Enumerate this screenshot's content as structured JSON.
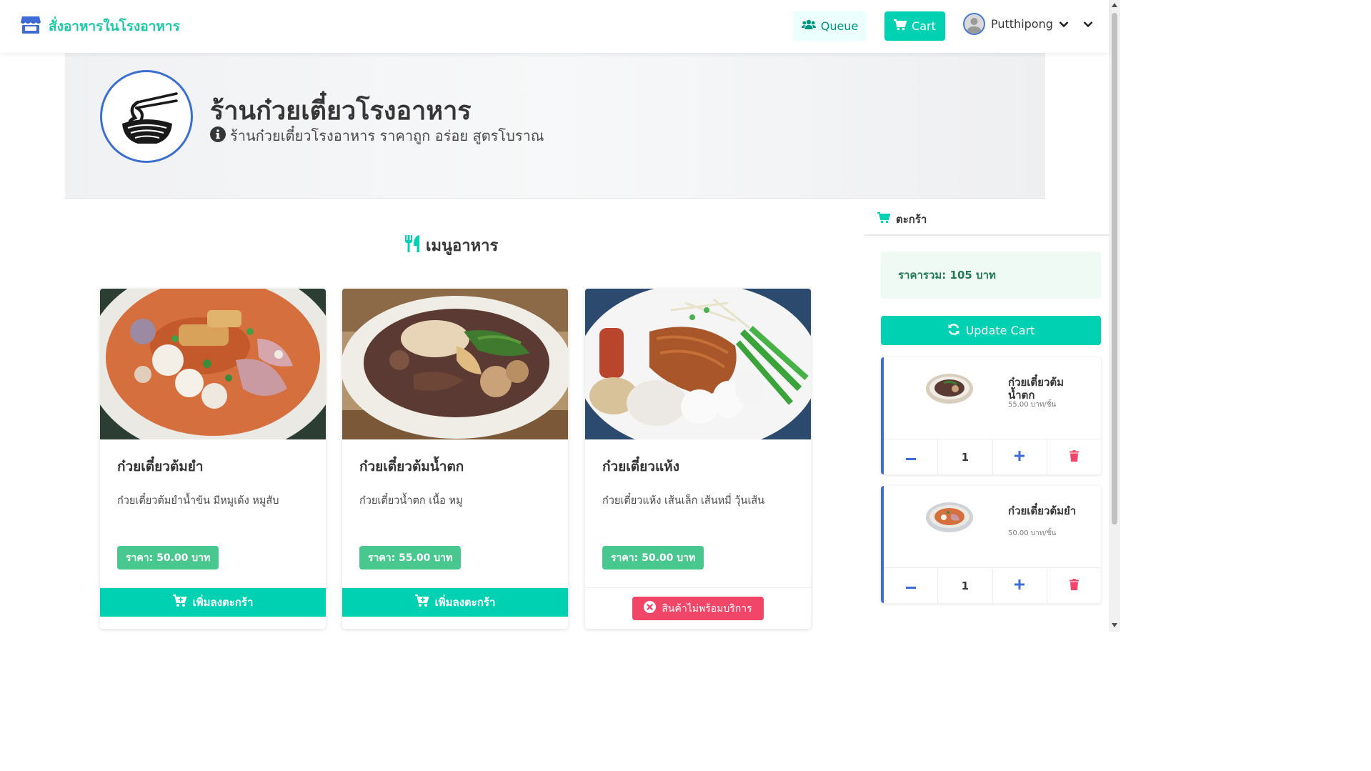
{
  "navbar": {
    "brand": "สั่งอาหารในโรงอาหาร",
    "queue_label": "Queue",
    "cart_label": "Cart",
    "user_name": "Putthipong"
  },
  "shop": {
    "name": "ร้านก๋วยเตี๋ยวโรงอาหาร",
    "description": "ร้านก๋วยเตี๋ยวโรงอาหาร ราคาถูก อร่อย สูตรโบราณ"
  },
  "menu": {
    "heading": "เมนูอาหาร",
    "items": [
      {
        "name": "ก๋วยเตี๋ยวต้มยำ",
        "description": "ก๋วยเตี๋ยวต้มยำน้ำข้น มีหมูเด้ง หมูสับ",
        "price": "ราคา: 50.00 บาท",
        "action": "เพิ่มลงตะกร้า",
        "available": true
      },
      {
        "name": "ก๋วยเตี๋ยวต้มน้ำตก",
        "description": "ก๋วยเตี๋ยวน้ำตก เนื้อ หมู",
        "price": "ราคา: 55.00 บาท",
        "action": "เพิ่มลงตะกร้า",
        "available": true
      },
      {
        "name": "ก๋วยเตี๋ยวแห้ง",
        "description": "ก๋วยเตี๋ยวแห้ง เส้นเล็ก เส้นหมี่ วุ้นเส้น",
        "price": "ราคา: 50.00 บาท",
        "action": "สินค้าไม่พร้อมบริการ",
        "available": false
      }
    ]
  },
  "cart": {
    "title": "ตะกร้า",
    "total": "ราคารวม: 105 บาท",
    "update_label": "Update Cart",
    "items": [
      {
        "name": "ก๋วยเตี๋ยวต้มน้ำตก",
        "unit_price": "55.00 บาท/ชิ้น",
        "quantity": "1"
      },
      {
        "name": "ก๋วยเตี๋ยวต้มยำ",
        "unit_price": "50.00 บาท/ชิ้น",
        "quantity": "1"
      }
    ]
  },
  "colors": {
    "primary": "#00d1b2",
    "success": "#48c78e",
    "danger": "#f14668",
    "link": "#3e6bd6"
  }
}
